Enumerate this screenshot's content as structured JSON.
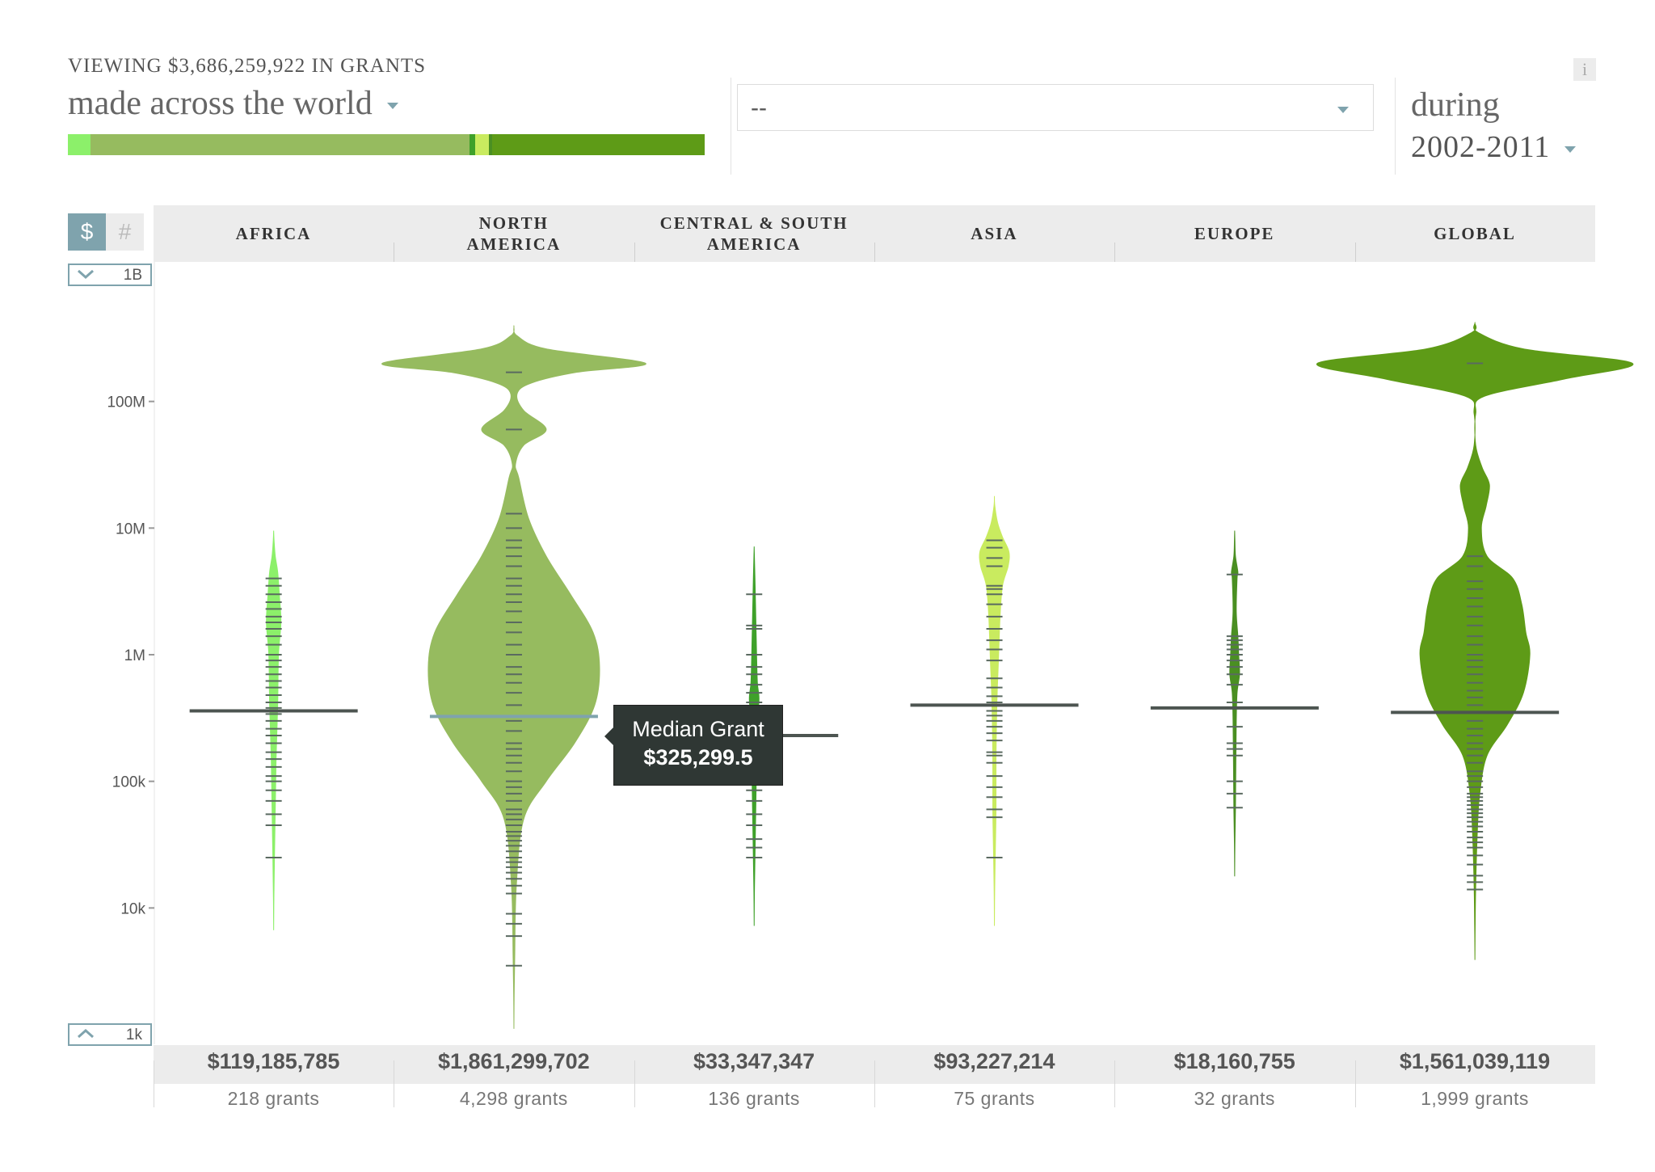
{
  "header": {
    "viewing_prefix": "VIEWING",
    "viewing_amount": "$3,686,259,922",
    "viewing_suffix": "IN GRANTS",
    "scope_label": "made across the world",
    "filter_value": "--",
    "during_label": "during",
    "period_value": "2002-2011",
    "info_label": "i"
  },
  "share_bar": [
    {
      "fraction": 0.036,
      "color": "#8cf06a"
    },
    {
      "fraction": 0.595,
      "color": "#96bb5f"
    },
    {
      "fraction": 0.008,
      "color": "#3fa12a"
    },
    {
      "fraction": 0.022,
      "color": "#c9eb5f"
    },
    {
      "fraction": 0.005,
      "color": "#4a8f22"
    },
    {
      "fraction": 0.334,
      "color": "#5e9b17"
    }
  ],
  "controls": {
    "dollar_label": "$",
    "count_label": "#",
    "range_max": "1B",
    "range_min": "1k",
    "range_max_icon": "chevron-down-icon",
    "range_min_icon": "chevron-up-icon"
  },
  "tooltip": {
    "title": "Median Grant",
    "value": "$325,299.5"
  },
  "chart_data": {
    "type": "violin",
    "y_scale": "log",
    "ylim": [
      1000,
      1000000000
    ],
    "y_ticks": [
      {
        "value": 1000,
        "label": "1k"
      },
      {
        "value": 10000,
        "label": "10k"
      },
      {
        "value": 100000,
        "label": "100k"
      },
      {
        "value": 1000000,
        "label": "1M"
      },
      {
        "value": 10000000,
        "label": "10M"
      },
      {
        "value": 100000000,
        "label": "100M"
      },
      {
        "value": 1000000000,
        "label": "1B"
      }
    ],
    "series": [
      {
        "name": "AFRICA",
        "color": "#8cf06a",
        "total": "$119,185,785",
        "count_label": "218 grants",
        "median": 360000,
        "violin": [
          [
            12000,
            0.3
          ],
          [
            25000,
            1
          ],
          [
            60000,
            2
          ],
          [
            150000,
            3
          ],
          [
            400000,
            5
          ],
          [
            1000000,
            6
          ],
          [
            1800000,
            9
          ],
          [
            3000000,
            7
          ],
          [
            4500000,
            5
          ],
          [
            6000000,
            2
          ],
          [
            8000000,
            0.5
          ]
        ],
        "ticks": [
          25000,
          45000,
          55000,
          70000,
          85000,
          100000,
          110000,
          130000,
          150000,
          170000,
          200000,
          230000,
          260000,
          300000,
          340000,
          380000,
          420000,
          480000,
          550000,
          620000,
          700000,
          800000,
          900000,
          1000000,
          1200000,
          1400000,
          1600000,
          1800000,
          2000000,
          2300000,
          2600000,
          3000000,
          3500000,
          4000000
        ]
      },
      {
        "name": "NORTH AMERICA",
        "color": "#96bb5f",
        "total": "$1,861,299,702",
        "count_label": "4,298 grants",
        "median": 325299.5,
        "violin": [
          [
            2000,
            0.3
          ],
          [
            4000,
            1
          ],
          [
            15000,
            3
          ],
          [
            50000,
            12
          ],
          [
            100000,
            40
          ],
          [
            200000,
            75
          ],
          [
            400000,
            100
          ],
          [
            800000,
            106
          ],
          [
            1500000,
            98
          ],
          [
            3000000,
            70
          ],
          [
            6000000,
            40
          ],
          [
            12000000,
            18
          ],
          [
            25000000,
            6
          ],
          [
            32000000,
            2
          ],
          [
            45000000,
            12
          ],
          [
            60000000,
            40
          ],
          [
            85000000,
            12
          ],
          [
            115000000,
            4
          ],
          [
            140000000,
            22
          ],
          [
            170000000,
            78
          ],
          [
            200000000,
            163
          ],
          [
            260000000,
            40
          ],
          [
            330000000,
            4
          ]
        ],
        "ticks": [
          3500,
          6000,
          7500,
          9000,
          13000,
          15000,
          17000,
          19000,
          21000,
          23000,
          25000,
          28000,
          31000,
          34000,
          37000,
          40000,
          45000,
          50000,
          55000,
          60000,
          70000,
          80000,
          90000,
          100000,
          120000,
          140000,
          160000,
          180000,
          200000,
          250000,
          300000,
          400000,
          500000,
          600000,
          700000,
          800000,
          1000000,
          1200000,
          1500000,
          1800000,
          2200000,
          2600000,
          3000000,
          3500000,
          4000000,
          5000000,
          6000000,
          7000000,
          8000000,
          10000000,
          13000000,
          60000000,
          170000000
        ]
      },
      {
        "name": "CENTRAL & SOUTH AMERICA",
        "color": "#3fa12a",
        "total": "$33,347,347",
        "count_label": "136 grants",
        "median": 230000,
        "violin": [
          [
            13000,
            0.3
          ],
          [
            25000,
            1
          ],
          [
            60000,
            2
          ],
          [
            150000,
            3
          ],
          [
            300000,
            4
          ],
          [
            450000,
            6
          ],
          [
            600000,
            4
          ],
          [
            1000000,
            3
          ],
          [
            2000000,
            2
          ],
          [
            4000000,
            1
          ],
          [
            6000000,
            0.3
          ]
        ],
        "ticks": [
          25000,
          30000,
          35000,
          45000,
          55000,
          70000,
          85000,
          100000,
          120000,
          150000,
          180000,
          220000,
          280000,
          350000,
          420000,
          500000,
          580000,
          700000,
          800000,
          1000000,
          1600000,
          1700000,
          3000000
        ]
      },
      {
        "name": "ASIA",
        "color": "#c9eb5f",
        "total": "$93,227,214",
        "count_label": "75 grants",
        "median": 400000,
        "violin": [
          [
            13000,
            0.3
          ],
          [
            25000,
            1
          ],
          [
            60000,
            2
          ],
          [
            150000,
            2
          ],
          [
            400000,
            3
          ],
          [
            900000,
            5
          ],
          [
            2000000,
            7
          ],
          [
            3500000,
            10
          ],
          [
            5000000,
            17
          ],
          [
            6500000,
            18
          ],
          [
            8500000,
            10
          ],
          [
            11000000,
            4
          ],
          [
            15000000,
            0.5
          ]
        ],
        "ticks": [
          25000,
          52000,
          60000,
          75000,
          90000,
          110000,
          140000,
          160000,
          170000,
          210000,
          240000,
          270000,
          300000,
          330000,
          360000,
          420000,
          470000,
          550000,
          650000,
          900000,
          1100000,
          1300000,
          1600000,
          2000000,
          2500000,
          3000000,
          3300000,
          3500000,
          5000000,
          5800000,
          7000000,
          8000000
        ]
      },
      {
        "name": "EUROPE",
        "color": "#4a8f22",
        "total": "$18,160,755",
        "count_label": "32 grants",
        "median": 380000,
        "violin": [
          [
            32000,
            0.3
          ],
          [
            60000,
            1
          ],
          [
            150000,
            1.5
          ],
          [
            300000,
            2
          ],
          [
            500000,
            3
          ],
          [
            700000,
            6
          ],
          [
            1000000,
            5
          ],
          [
            1400000,
            4
          ],
          [
            2200000,
            2
          ],
          [
            4000000,
            3
          ],
          [
            4500000,
            4
          ],
          [
            6000000,
            1
          ],
          [
            8000000,
            0.3
          ]
        ],
        "ticks": [
          62000,
          80000,
          100000,
          160000,
          180000,
          200000,
          270000,
          380000,
          420000,
          580000,
          700000,
          800000,
          900000,
          1000000,
          1100000,
          1200000,
          1300000,
          1400000,
          4300000
        ]
      },
      {
        "name": "GLOBAL",
        "color": "#5e9b17",
        "total": "$1,561,039,119",
        "count_label": "1,999 grants",
        "median": 350000,
        "violin": [
          [
            7000,
            0.3
          ],
          [
            15000,
            1
          ],
          [
            40000,
            3
          ],
          [
            80000,
            6
          ],
          [
            160000,
            15
          ],
          [
            280000,
            40
          ],
          [
            500000,
            60
          ],
          [
            1000000,
            68
          ],
          [
            1500000,
            63
          ],
          [
            2500000,
            58
          ],
          [
            4000000,
            47
          ],
          [
            6000000,
            15
          ],
          [
            10000000,
            8
          ],
          [
            15000000,
            14
          ],
          [
            22000000,
            18
          ],
          [
            30000000,
            9
          ],
          [
            45000000,
            1
          ],
          [
            80000000,
            1
          ],
          [
            110000000,
            12
          ],
          [
            150000000,
            110
          ],
          [
            200000000,
            195
          ],
          [
            260000000,
            60
          ],
          [
            350000000,
            4
          ]
        ],
        "ticks": [
          14000,
          16000,
          18000,
          22000,
          26000,
          30000,
          33000,
          36000,
          40000,
          44000,
          48000,
          52000,
          56000,
          60000,
          65000,
          70000,
          75000,
          80000,
          90000,
          100000,
          110000,
          120000,
          140000,
          160000,
          180000,
          200000,
          230000,
          260000,
          300000,
          350000,
          400000,
          460000,
          520000,
          600000,
          700000,
          800000,
          900000,
          1000000,
          1200000,
          1400000,
          1700000,
          2000000,
          2400000,
          2800000,
          3300000,
          3800000,
          5000000,
          6000000,
          200000000
        ]
      }
    ]
  }
}
